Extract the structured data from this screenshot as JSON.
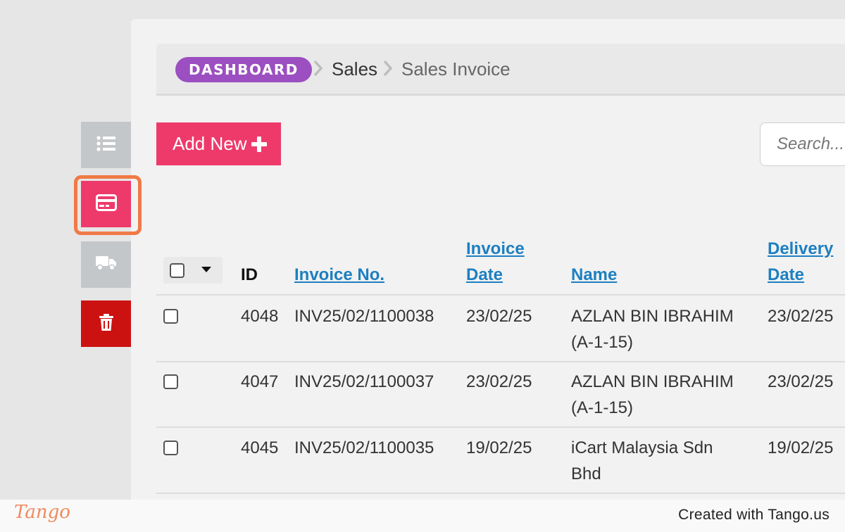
{
  "breadcrumb": {
    "dashboard": "DASHBOARD",
    "sales": "Sales",
    "current": "Sales Invoice"
  },
  "toolbar": {
    "add_new_label": "Add New",
    "search_placeholder": "Search..."
  },
  "sidebar": {
    "items": [
      {
        "icon": "list-icon"
      },
      {
        "icon": "credit-card-icon",
        "active": true
      },
      {
        "icon": "truck-icon"
      },
      {
        "icon": "trash-icon"
      }
    ]
  },
  "table": {
    "headers": {
      "id": "ID",
      "invoice_no": "Invoice No.",
      "invoice_date_1": "Invoice",
      "invoice_date_2": "Date",
      "name": "Name",
      "delivery_date_1": "Delivery",
      "delivery_date_2": "Date"
    },
    "rows": [
      {
        "id": "4048",
        "invoice_no": "INV25/02/1100038",
        "invoice_date": "23/02/25",
        "name_1": "AZLAN BIN IBRAHIM",
        "name_2": "(A-1-15)",
        "delivery_date": "23/02/25"
      },
      {
        "id": "4047",
        "invoice_no": "INV25/02/1100037",
        "invoice_date": "23/02/25",
        "name_1": "AZLAN BIN IBRAHIM",
        "name_2": "(A-1-15)",
        "delivery_date": "23/02/25"
      },
      {
        "id": "4045",
        "invoice_no": "INV25/02/1100035",
        "invoice_date": "19/02/25",
        "name_1": "iCart Malaysia Sdn",
        "name_2": "Bhd",
        "delivery_date": "19/02/25"
      }
    ]
  },
  "footer": {
    "logo": "Tango",
    "created": "Created with Tango.us"
  },
  "colors": {
    "accent": "#ee3a6b",
    "breadcrumb_pill": "#9b4fc0",
    "link": "#1d7fc0",
    "danger": "#cc1111",
    "highlight": "#f07a46"
  }
}
